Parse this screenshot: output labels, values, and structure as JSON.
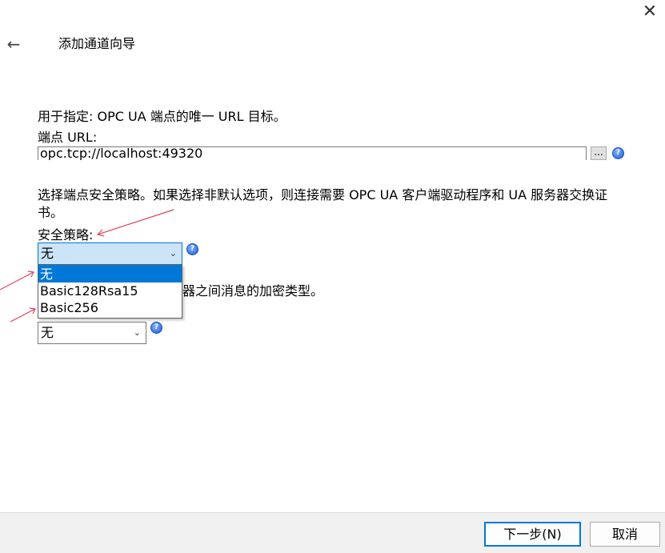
{
  "window": {
    "title": "添加通道向导",
    "close_glyph": "✕",
    "back_glyph": "←"
  },
  "endpoint": {
    "description": "用于指定:  OPC UA 端点的唯一 URL 目标。",
    "label": "端点 URL:",
    "value": "opc.tcp://localhost:49320",
    "browse_label": "..."
  },
  "security_policy": {
    "description_line1": "选择端点安全策略。如果选择非默认选项，则连接需要 OPC UA 客户端驱动程序和 UA 服务器交换证",
    "description_line2": "书。",
    "label": "安全策略:",
    "selected": "无",
    "options": [
      "无",
      "Basic128Rsa15",
      "Basic256"
    ]
  },
  "message_mode": {
    "description_partial": "器之间消息的加密类型。",
    "selected": "无"
  },
  "footer": {
    "next_label": "下一步(N)",
    "cancel_label": "取消"
  },
  "help_glyph": "?",
  "colors": {
    "accent": "#0078d7",
    "annotation_arrow": "#e0455a"
  }
}
